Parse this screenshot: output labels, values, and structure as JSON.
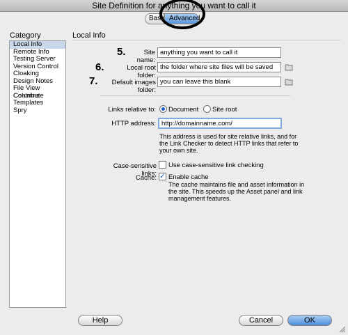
{
  "window": {
    "title": "Site Definition for anything you want to call it"
  },
  "tabs": [
    {
      "label": "Basic"
    },
    {
      "label": "Advanced"
    }
  ],
  "category": {
    "title": "Category",
    "items": [
      "Local Info",
      "Remote Info",
      "Testing Server",
      "Version Control",
      "Cloaking",
      "Design Notes",
      "File View Columns",
      "Contribute",
      "Templates",
      "Spry"
    ]
  },
  "panel": {
    "title": "Local Info",
    "site_name": {
      "step": "5.",
      "label": "Site name:",
      "value": "anything you want to call it"
    },
    "local_root": {
      "step": "6.",
      "label": "Local root folder:",
      "value": "the folder where site files will be saved"
    },
    "default_images": {
      "step": "7.",
      "label": "Default images folder:",
      "value": "you can leave this blank"
    },
    "links_relative": {
      "label": "Links relative to:",
      "option_document": "Document",
      "option_site_root": "Site root"
    },
    "http": {
      "label": "HTTP address:",
      "value": "http://domainname.com/",
      "help_lines": [
        "This address is used for site relative links, and for",
        "the Link Checker to detect HTTP links that refer to",
        "your own site."
      ]
    },
    "case_sensitive": {
      "label": "Case-sensitive links:",
      "option": "Use case-sensitive link checking",
      "checked": false
    },
    "cache": {
      "label": "Cache:",
      "option": "Enable cache",
      "checked": true,
      "help_lines": [
        "The cache maintains file and asset information in",
        "the site.  This speeds up the Asset panel and link",
        "management features."
      ]
    }
  },
  "buttons": {
    "help": "Help",
    "cancel": "Cancel",
    "ok": "OK"
  }
}
